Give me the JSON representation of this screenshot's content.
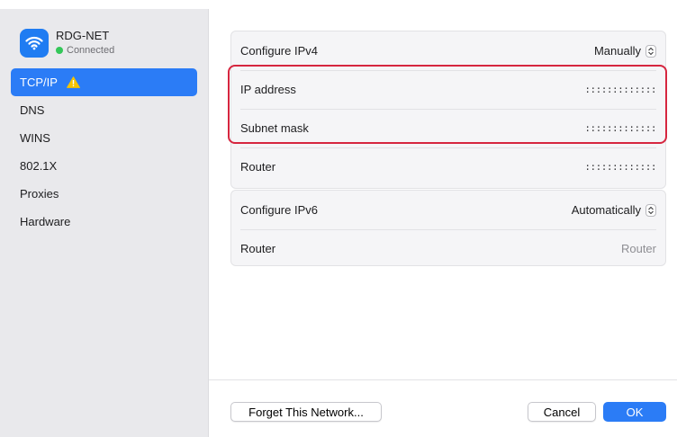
{
  "network": {
    "name": "RDG-NET",
    "status": "Connected",
    "status_color": "#34c759",
    "icon": "wifi-icon",
    "icon_bg": "#1f7cf2"
  },
  "sidebar": {
    "items": [
      {
        "label": "TCP/IP",
        "selected": true,
        "warning": true
      },
      {
        "label": "DNS"
      },
      {
        "label": "WINS"
      },
      {
        "label": "802.1X"
      },
      {
        "label": "Proxies"
      },
      {
        "label": "Hardware"
      }
    ]
  },
  "ipv4": {
    "configure_label": "Configure IPv4",
    "configure_value": "Manually",
    "ip_label": "IP address",
    "ip_value": ":::::::::::::",
    "subnet_label": "Subnet mask",
    "subnet_value": ":::::::::::::",
    "router_label": "Router",
    "router_value": ":::::::::::::"
  },
  "ipv6": {
    "configure_label": "Configure IPv6",
    "configure_value": "Automatically",
    "router_label": "Router",
    "router_placeholder": "Router"
  },
  "footer": {
    "forget_label": "Forget This Network...",
    "cancel_label": "Cancel",
    "ok_label": "OK"
  },
  "colors": {
    "accent": "#2b7cf6",
    "highlight": "#d6263f",
    "warning": "#f5c400"
  }
}
